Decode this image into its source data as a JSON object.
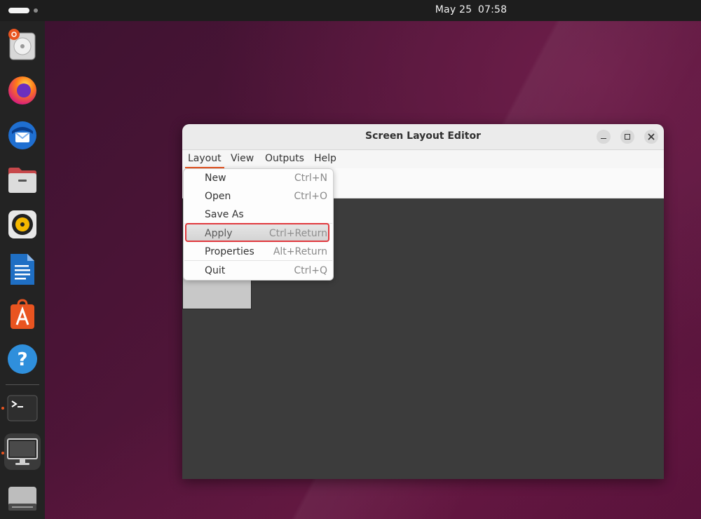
{
  "topbar": {
    "date": "May 25",
    "time": "07:58"
  },
  "dock": {
    "items": [
      {
        "name": "disk-usage-icon"
      },
      {
        "name": "firefox-icon"
      },
      {
        "name": "thunderbird-icon"
      },
      {
        "name": "files-icon"
      },
      {
        "name": "rhythmbox-icon"
      },
      {
        "name": "writer-icon"
      },
      {
        "name": "app-center-icon"
      },
      {
        "name": "help-icon"
      },
      {
        "name": "terminal-icon"
      },
      {
        "name": "display-icon"
      },
      {
        "name": "drive-icon"
      }
    ]
  },
  "window": {
    "title": "Screen Layout Editor",
    "menubar": [
      "Layout",
      "View",
      "Outputs",
      "Help"
    ]
  },
  "dropdown": {
    "items": [
      {
        "label": "New",
        "accel": "Ctrl+N"
      },
      {
        "label": "Open",
        "accel": "Ctrl+O"
      },
      {
        "label": "Save As",
        "accel": ""
      },
      {
        "label": "Apply",
        "accel": "Ctrl+Return"
      },
      {
        "label": "Properties",
        "accel": "Alt+Return"
      },
      {
        "label": "Quit",
        "accel": "Ctrl+Q"
      }
    ]
  },
  "colors": {
    "accent": "#e95420",
    "highlight_border": "#e0393e"
  }
}
